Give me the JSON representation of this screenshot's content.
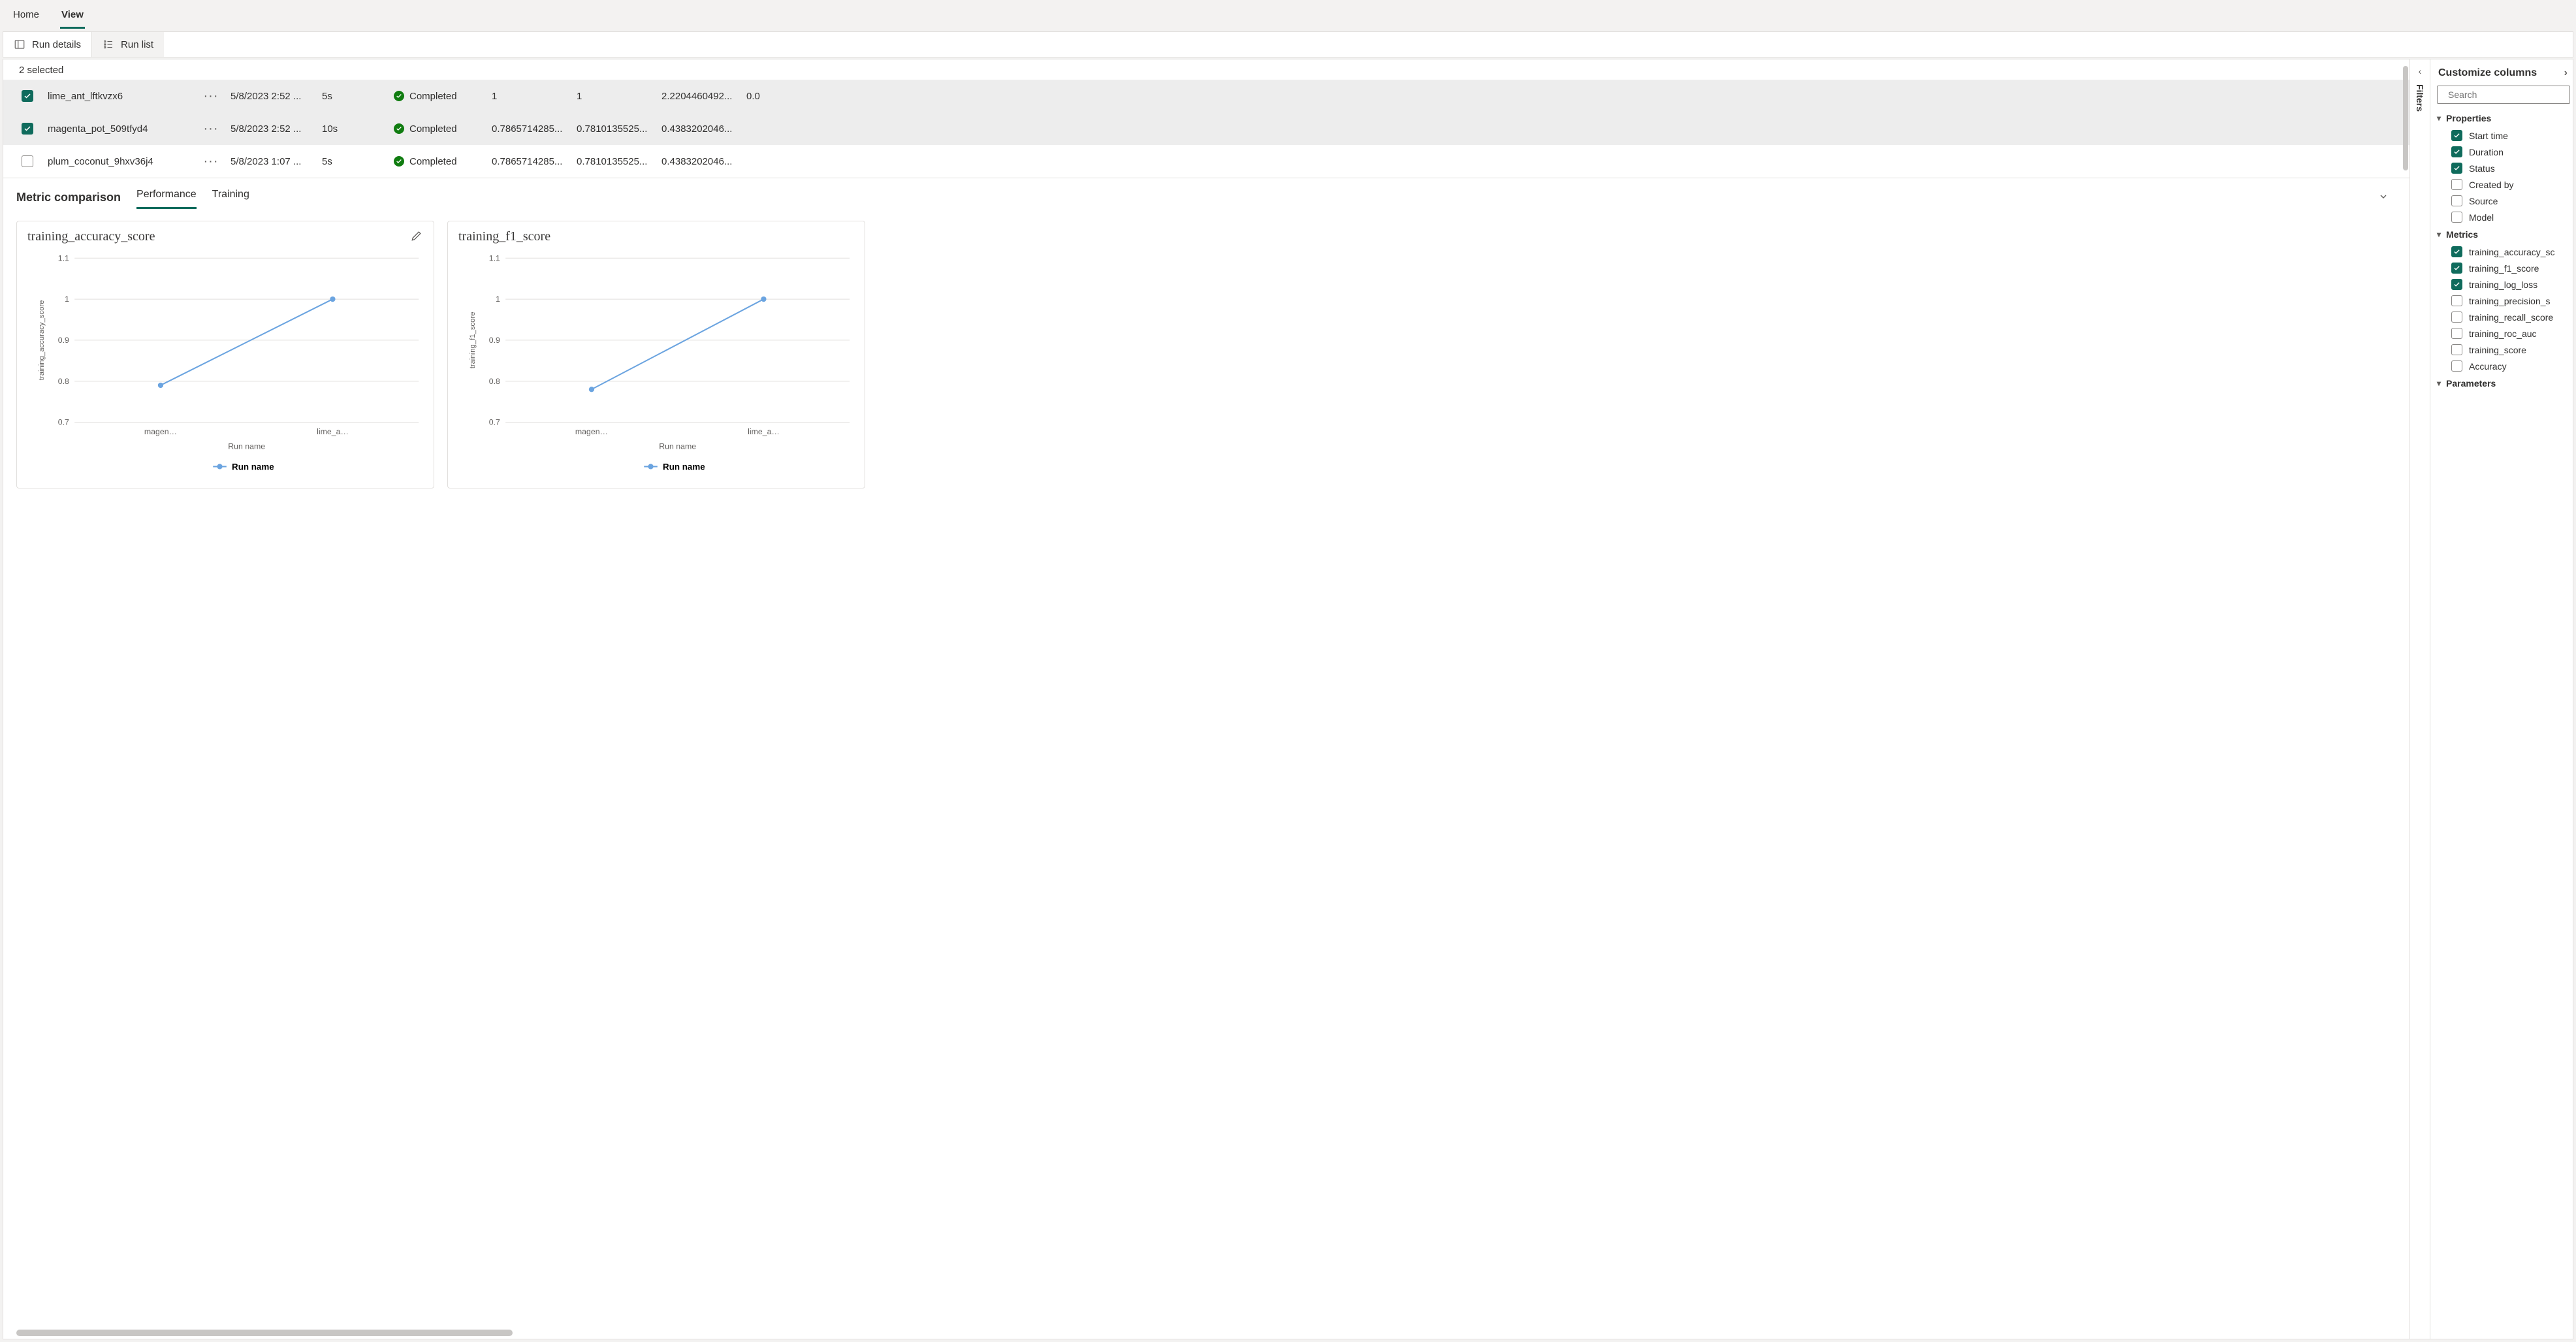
{
  "nav": {
    "tabs": [
      "Home",
      "View"
    ],
    "active": 1
  },
  "toolbar": {
    "run_details": "Run details",
    "run_list": "Run list",
    "active": 0
  },
  "table": {
    "selected_count_label": "2 selected",
    "rows": [
      {
        "checked": true,
        "name": "lime_ant_lftkvzx6",
        "time": "5/8/2023 2:52 ...",
        "dur": "5s",
        "status": "Completed",
        "c1": "1",
        "c2": "1",
        "c3": "2.2204460492...",
        "c4": "0.0"
      },
      {
        "checked": true,
        "name": "magenta_pot_509tfyd4",
        "time": "5/8/2023 2:52 ...",
        "dur": "10s",
        "status": "Completed",
        "c1": "0.7865714285...",
        "c2": "0.7810135525...",
        "c3": "0.4383202046...",
        "c4": ""
      },
      {
        "checked": false,
        "name": "plum_coconut_9hxv36j4",
        "time": "5/8/2023 1:07 ...",
        "dur": "5s",
        "status": "Completed",
        "c1": "0.7865714285...",
        "c2": "0.7810135525...",
        "c3": "0.4383202046...",
        "c4": ""
      }
    ]
  },
  "metric_panel": {
    "title": "Metric comparison",
    "tabs": [
      "Performance",
      "Training"
    ],
    "active": 0
  },
  "filters_rail": {
    "label": "Filters"
  },
  "customize": {
    "title": "Customize columns",
    "search_placeholder": "Search",
    "groups": [
      {
        "name": "Properties",
        "items": [
          {
            "label": "Start time",
            "on": true
          },
          {
            "label": "Duration",
            "on": true
          },
          {
            "label": "Status",
            "on": true
          },
          {
            "label": "Created by",
            "on": false
          },
          {
            "label": "Source",
            "on": false
          },
          {
            "label": "Model",
            "on": false
          }
        ]
      },
      {
        "name": "Metrics",
        "items": [
          {
            "label": "training_accuracy_sc",
            "on": true
          },
          {
            "label": "training_f1_score",
            "on": true
          },
          {
            "label": "training_log_loss",
            "on": true
          },
          {
            "label": "training_precision_s",
            "on": false
          },
          {
            "label": "training_recall_score",
            "on": false
          },
          {
            "label": "training_roc_auc",
            "on": false
          },
          {
            "label": "training_score",
            "on": false
          },
          {
            "label": "Accuracy",
            "on": false
          }
        ]
      },
      {
        "name": "Parameters",
        "items": []
      }
    ]
  },
  "chart_data": [
    {
      "type": "line",
      "title": "training_accuracy_score",
      "xlabel": "Run name",
      "ylabel": "training_accuracy_score",
      "legend": "Run name",
      "categories": [
        "magen…",
        "lime_a…"
      ],
      "values": [
        0.79,
        1.0
      ],
      "ylim": [
        0.7,
        1.1
      ],
      "yticks": [
        0.7,
        0.8,
        0.9,
        1,
        1.1
      ],
      "editable": true
    },
    {
      "type": "line",
      "title": "training_f1_score",
      "xlabel": "Run name",
      "ylabel": "training_f1_score",
      "legend": "Run name",
      "categories": [
        "magen…",
        "lime_a…"
      ],
      "values": [
        0.78,
        1.0
      ],
      "ylim": [
        0.7,
        1.1
      ],
      "yticks": [
        0.7,
        0.8,
        0.9,
        1,
        1.1
      ],
      "editable": false
    }
  ]
}
